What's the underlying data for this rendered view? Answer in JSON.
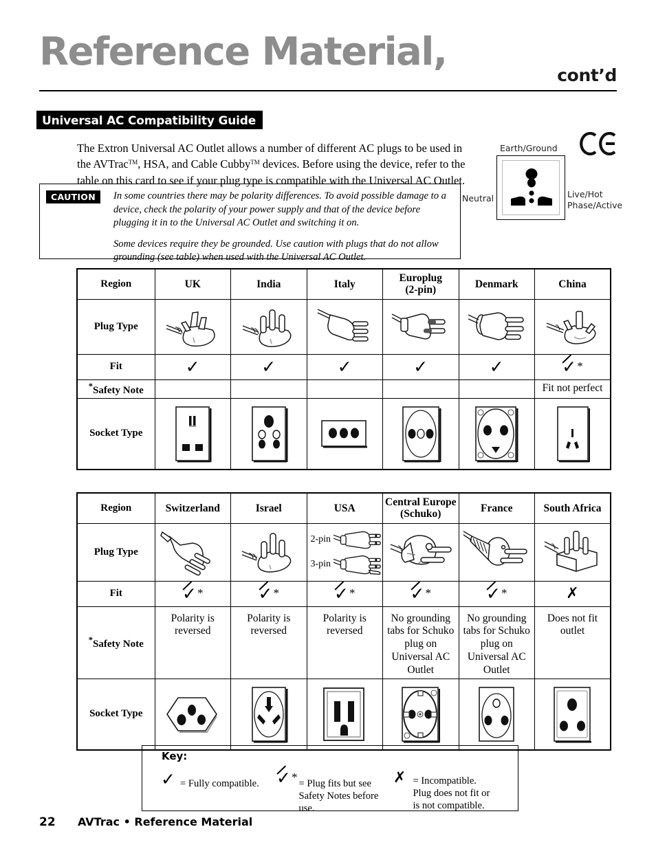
{
  "header": {
    "title": "Reference Material,",
    "contd": "cont’d"
  },
  "section": {
    "title": "Universal AC Compatibility Guide"
  },
  "intro": {
    "line1": "The Extron Universal AC Outlet allows a number of different AC plugs to be used in",
    "line2_a": "the AVTrac",
    "tm1": "TM",
    "line2_b": ", HSA, and Cable Cubby",
    "tm2": "TM",
    "line2_c": " devices.  Before using the device, refer to the",
    "line3": "table on this card to see if your plug type is compatible with the Universal AC Outlet."
  },
  "caution": {
    "tag": "CAUTION",
    "paragraph1": "In some countries there may be polarity differences.  To avoid possible damage to a device, check the polarity of your power supply and that of the device before plugging it in to the Universal AC Outlet and switching it on.",
    "paragraph2": "Some devices require they be grounded.  Use caution with plugs that do not allow grounding (see table) when used with the Universal AC Outlet."
  },
  "outlet_diagram": {
    "label_earth": "Earth/Ground",
    "label_neutral": "Neutral",
    "label_live_line1": "Live/Hot",
    "label_live_line2": "Phase/Active",
    "ce_mark": "CE"
  },
  "tables": {
    "row_labels": {
      "region": "Region",
      "plug_type": "Plug Type",
      "fit": "Fit",
      "safety_note": "Safety Note",
      "socket_type": "Socket Type",
      "note_asterisk": "*"
    },
    "table1": {
      "regions": [
        "UK",
        "India",
        "Italy",
        "Europlug\n(2-pin)",
        "Denmark",
        "China"
      ],
      "fit": [
        "check",
        "check",
        "check",
        "check",
        "check",
        "check-star"
      ],
      "safety_notes": [
        "",
        "",
        "",
        "",
        "",
        "Fit not perfect"
      ],
      "plug_icons": [
        "uk-plug-icon",
        "india-plug-icon",
        "italy-plug-icon",
        "europlug-plug-icon",
        "denmark-plug-icon",
        "china-plug-icon"
      ],
      "socket_icons": [
        "uk-socket-icon",
        "india-socket-icon",
        "italy-socket-icon",
        "europlug-socket-icon",
        "denmark-socket-icon",
        "china-socket-icon"
      ]
    },
    "table2": {
      "regions": [
        "Switzerland",
        "Israel",
        "USA",
        "Central Europe\n(Schuko)",
        "France",
        "South Africa"
      ],
      "fit": [
        "check-star",
        "check-star",
        "check-star",
        "check-star",
        "check-star",
        "x"
      ],
      "safety_notes": [
        "Polarity is reversed",
        "Polarity is reversed",
        "Polarity is reversed",
        "No grounding tabs for Schuko plug on Universal AC Outlet",
        "No grounding tabs for Schuko plug on Universal AC Outlet",
        "Does not fit outlet"
      ],
      "usa_sublabels": [
        "2-pin",
        "3-pin"
      ],
      "plug_icons": [
        "switzerland-plug-icon",
        "israel-plug-icon",
        "usa-plug-icon",
        "schuko-plug-icon",
        "france-plug-icon",
        "south-africa-plug-icon"
      ],
      "socket_icons": [
        "switzerland-socket-icon",
        "israel-socket-icon",
        "usa-socket-icon",
        "schuko-socket-icon",
        "france-socket-icon",
        "south-africa-socket-icon"
      ]
    }
  },
  "key": {
    "title": "Key:",
    "item1": "=  Fully compatible.",
    "item2": "= Plug fits but see\nSafety Notes before\nuse.",
    "item3": "= Incompatible.\nPlug does not fit or\nis not compatible."
  },
  "footer": {
    "page_number": "22",
    "text": "AVTrac • Reference Material"
  },
  "colors": {
    "title_gray": "#8d8d8d",
    "black": "#000000",
    "white": "#ffffff"
  }
}
